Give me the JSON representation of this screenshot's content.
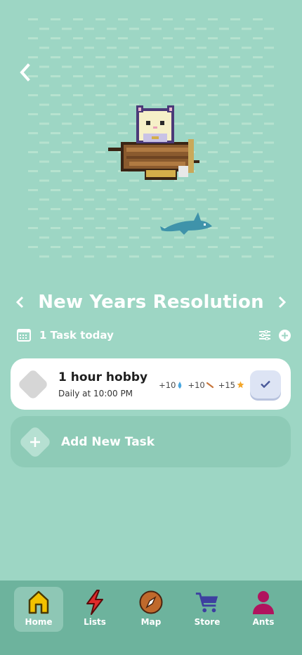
{
  "list": {
    "title": "New Years Resolution",
    "task_count": "1 Task today"
  },
  "task": {
    "name": "1 hour hobby",
    "schedule": "Daily at 10:00 PM",
    "rewards": [
      {
        "amount": "+10",
        "icon": "water-drop-icon"
      },
      {
        "amount": "+10",
        "icon": "stick-icon"
      },
      {
        "amount": "+15",
        "icon": "star-icon"
      }
    ]
  },
  "add_task": {
    "label": "Add New Task"
  },
  "nav": {
    "items": [
      {
        "label": "Home",
        "icon": "home-icon",
        "active": true
      },
      {
        "label": "Lists",
        "icon": "lightning-icon",
        "active": false
      },
      {
        "label": "Map",
        "icon": "compass-icon",
        "active": false
      },
      {
        "label": "Store",
        "icon": "cart-icon",
        "active": false
      },
      {
        "label": "Ants",
        "icon": "person-icon",
        "active": false
      }
    ]
  },
  "colors": {
    "background": "#9dd6c4",
    "nav_background": "#6db39d",
    "home": "#f2c200",
    "lists": "#e02b2b",
    "map": "#c0692c",
    "store": "#3d3fa0",
    "ants": "#b0145e"
  }
}
